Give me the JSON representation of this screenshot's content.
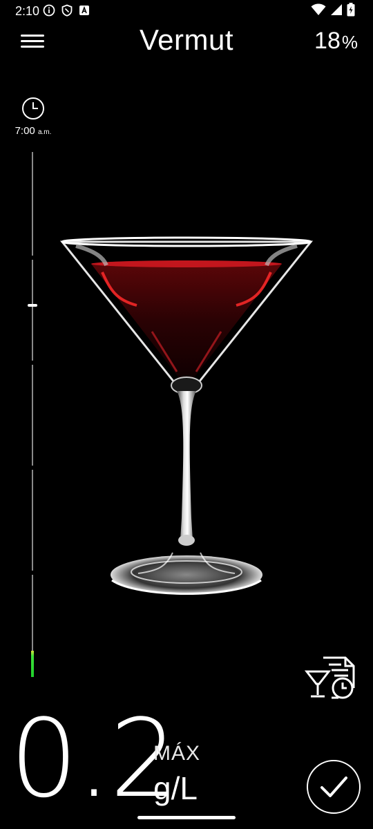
{
  "status_bar": {
    "time": "2:10",
    "icons_left": [
      "info-icon",
      "shield-icon",
      "font-icon"
    ],
    "icons_right": [
      "wifi-icon",
      "signal-icon",
      "battery-charging-icon"
    ]
  },
  "header": {
    "title": "Vermut",
    "abv_value": "18",
    "abv_unit": "%",
    "menu_icon": "hamburger-menu-icon"
  },
  "time_marker": {
    "icon": "clock-icon",
    "time": "7:00",
    "period": "a.m."
  },
  "timeline": {
    "fill_fraction": 0.05,
    "handle_fraction": 0.71,
    "fill_colors": [
      "#1fd12a",
      "#d9e23a"
    ]
  },
  "drink_image": "martini-glass-with-red-vermouth",
  "history_button": {
    "icon": "drink-history-icon"
  },
  "reading": {
    "value": "0.2",
    "max_label": "MÁX",
    "unit": "g/L"
  },
  "confirm_button": {
    "icon": "checkmark-icon"
  }
}
